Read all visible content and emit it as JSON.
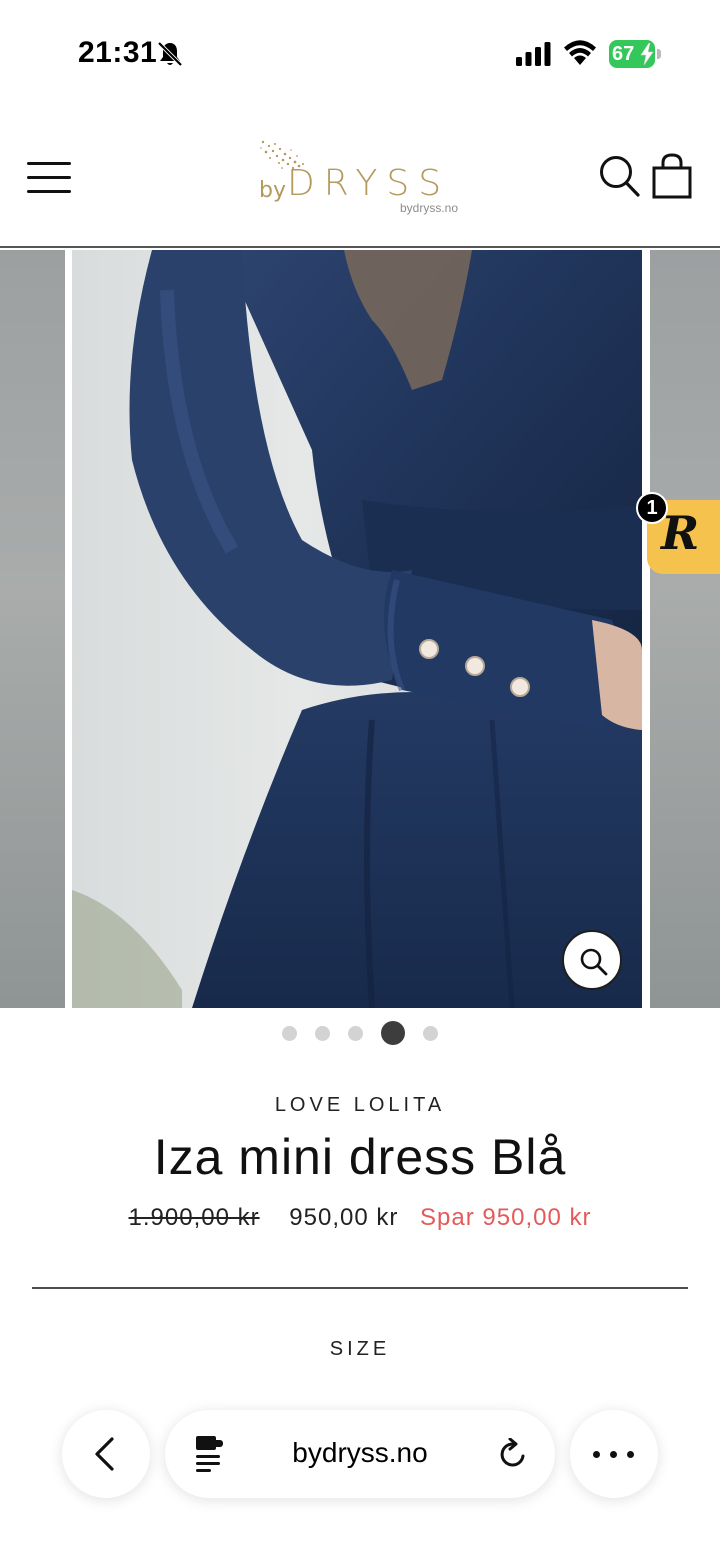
{
  "status_bar": {
    "time": "21:31",
    "battery_level": "67",
    "icons": [
      "bell-slash-icon",
      "signal-icon",
      "wifi-icon",
      "battery-charging-icon"
    ]
  },
  "header": {
    "logo_prefix": "by",
    "logo_word": "DRYSS",
    "logo_domain": "bydryss.no",
    "icons": [
      "hamburger-menu-icon",
      "search-icon",
      "shopping-bag-icon"
    ]
  },
  "gallery": {
    "slide_count": 5,
    "active_index": 3,
    "zoom_icon": "zoom-icon"
  },
  "rewards": {
    "letter": "R",
    "count": "1"
  },
  "product": {
    "brand": "LOVE LOLITA",
    "title": "Iza mini dress Blå",
    "price_original": "1.900,00 kr",
    "price_sale": "950,00 kr",
    "price_savings": "Spar 950,00 kr",
    "size_label": "SIZE"
  },
  "browser": {
    "address": "bydryss.no",
    "icons": [
      "chevron-left-icon",
      "reader-icon",
      "reload-icon",
      "more-icon"
    ]
  },
  "colors": {
    "logo_gold": "#b39a5c",
    "sale_red": "#e45a5a",
    "rewards_yellow": "#f6c24e",
    "dress_navy": "#1f3358",
    "battery_green": "#34c759"
  }
}
